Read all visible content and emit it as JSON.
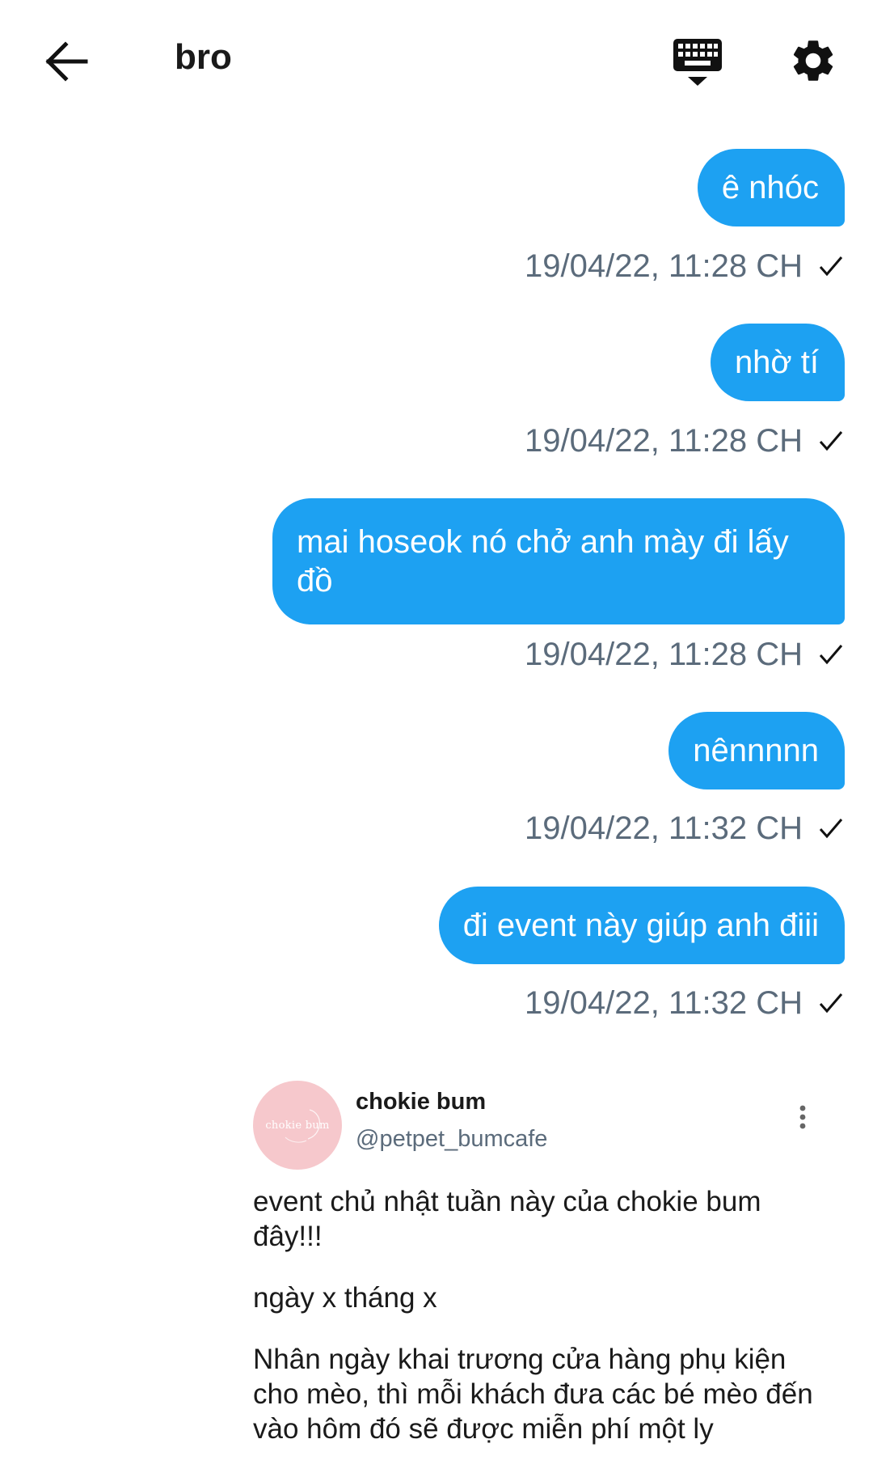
{
  "header": {
    "title": "bro",
    "icons": {
      "back": "arrow-left-icon",
      "keyboard": "keyboard-hide-icon",
      "settings": "gear-icon"
    }
  },
  "messages": [
    {
      "text": "ê nhóc",
      "time": "19/04/22, 11:28 CH"
    },
    {
      "text": "nhờ tí",
      "time": "19/04/22, 11:28 CH"
    },
    {
      "text": "mai hoseok nó chở anh mày đi lấy đồ",
      "time": "19/04/22, 11:28 CH"
    },
    {
      "text": "nênnnnn",
      "time": "19/04/22, 11:32 CH"
    },
    {
      "text": "đi event này giúp anh điii",
      "time": "19/04/22, 11:32 CH"
    }
  ],
  "shared_post": {
    "name": "chokie bum",
    "handle": "@petpet_bumcafe",
    "avatar_text": "chokie bum",
    "paragraphs": [
      "event chủ nhật tuần này của chokie bum đây!!!",
      "ngày x tháng x",
      "Nhân ngày khai trương cửa hàng phụ kiện cho mèo, thì mỗi khách đưa các bé mèo đến vào hôm đó sẽ được miễn phí một ly"
    ]
  },
  "colors": {
    "bubble": "#1da1f2",
    "meta": "#5b6b7b",
    "avatar_bg": "#f6c8cc"
  }
}
